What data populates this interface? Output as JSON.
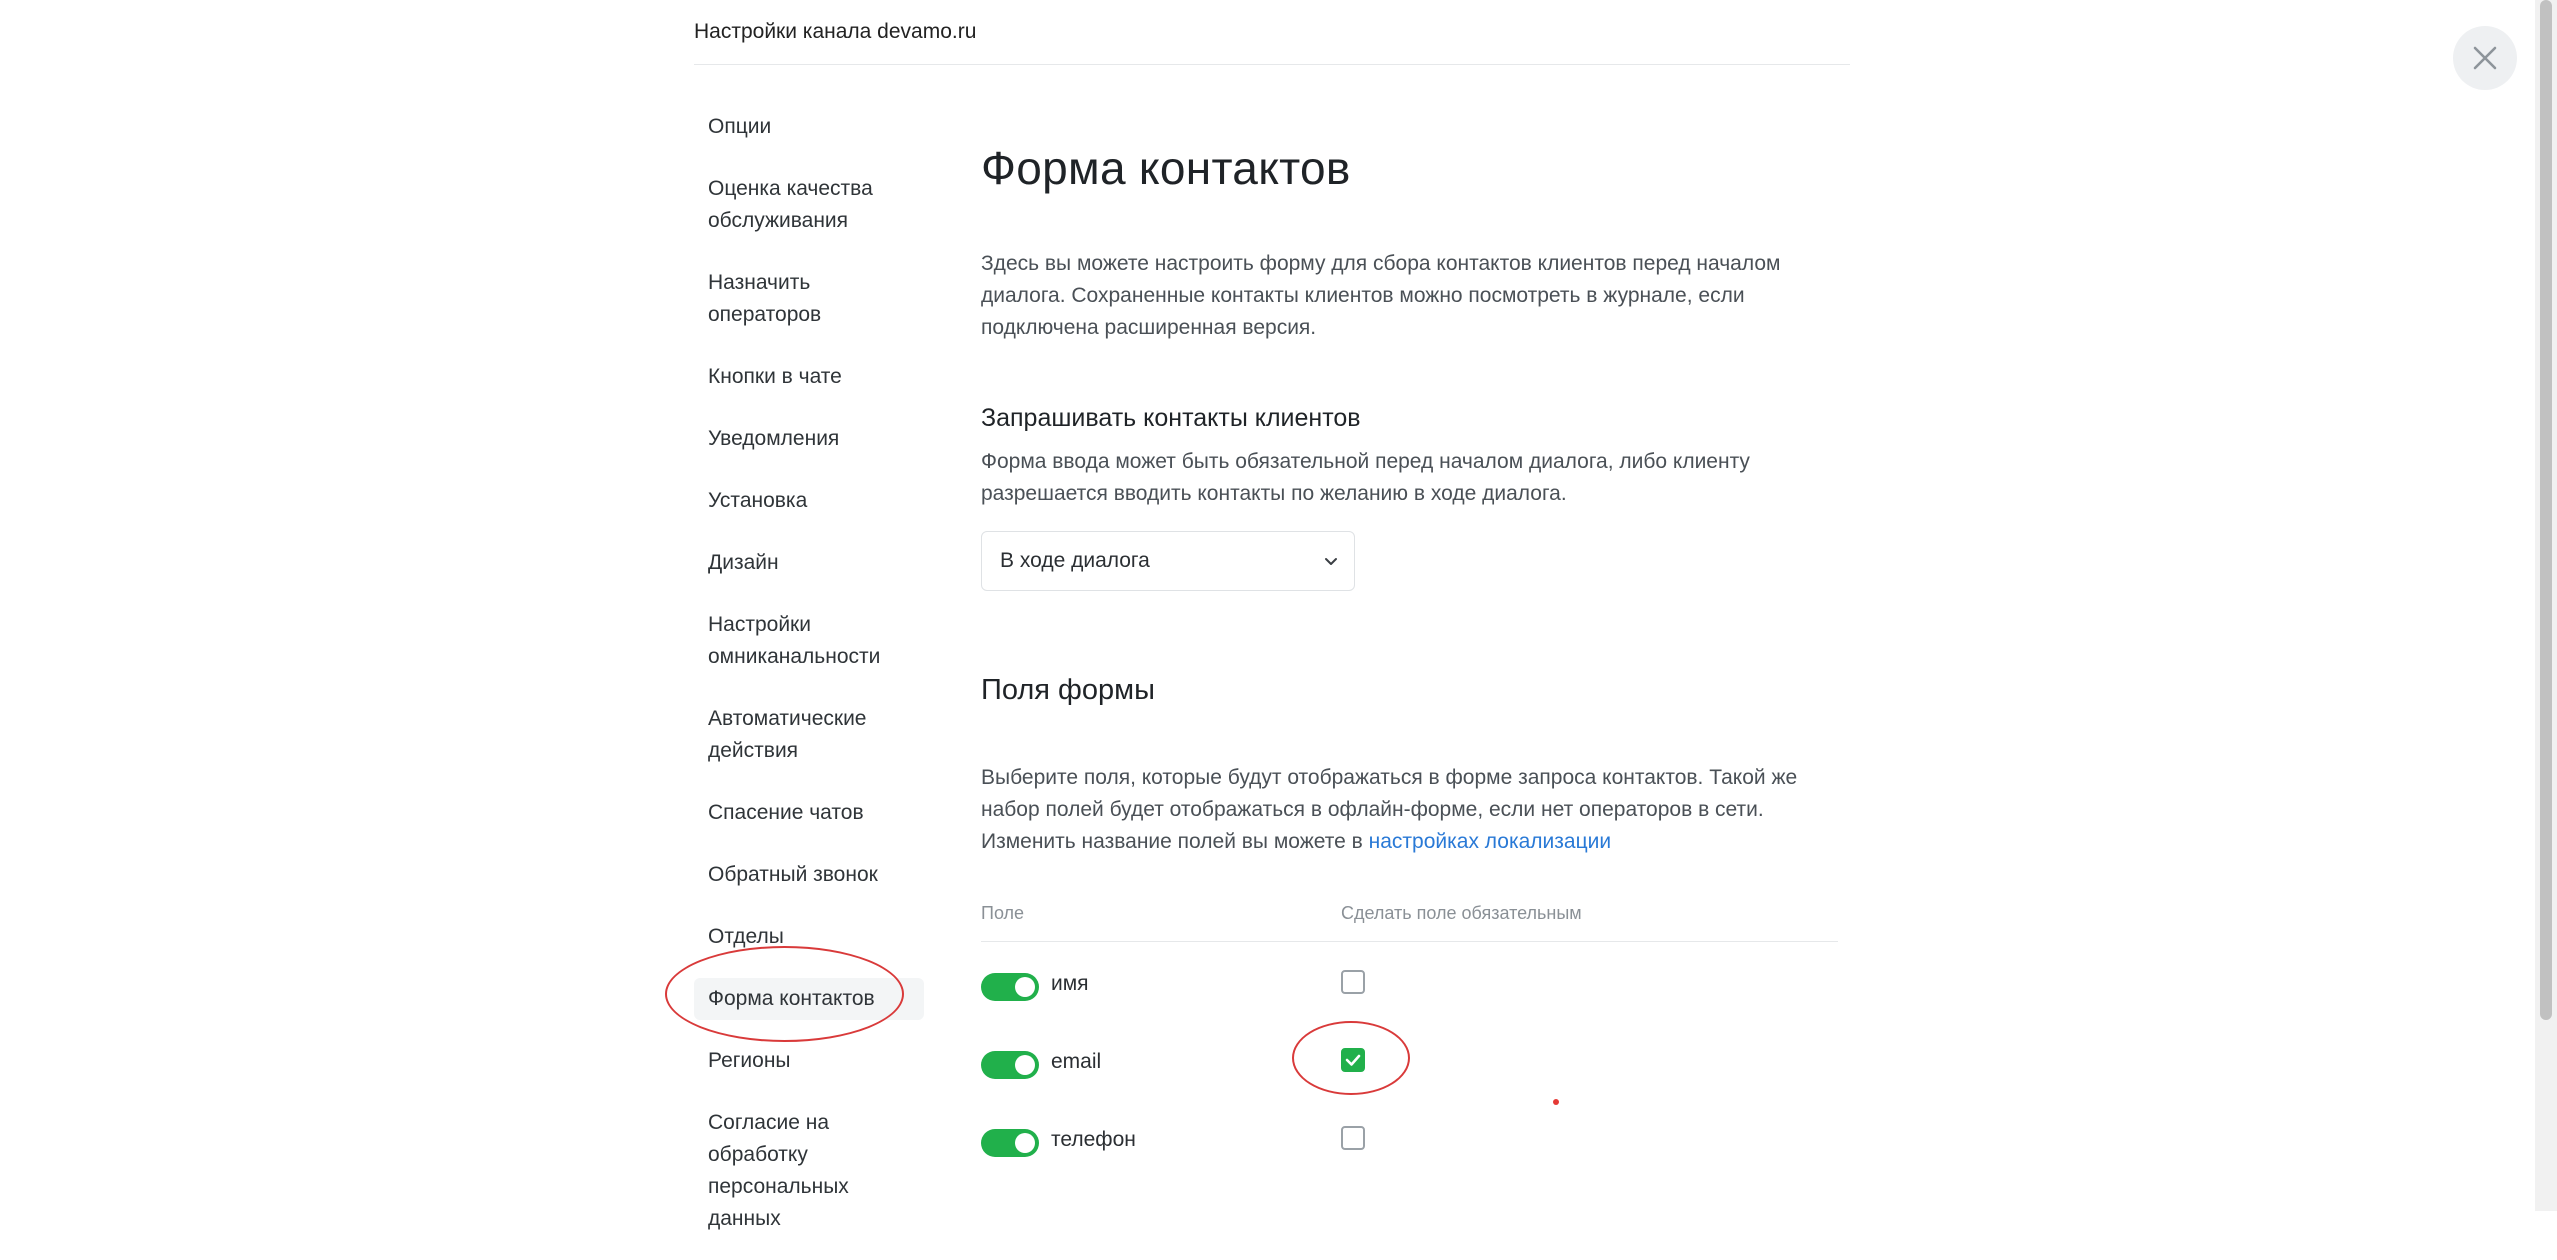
{
  "header": {
    "title": "Настройки канала devamo.ru"
  },
  "sidebar": {
    "items": [
      {
        "label": "Опции"
      },
      {
        "label": "Оценка качества обслуживания"
      },
      {
        "label": "Назначить операторов"
      },
      {
        "label": "Кнопки в чате"
      },
      {
        "label": "Уведомления"
      },
      {
        "label": "Установка"
      },
      {
        "label": "Дизайн"
      },
      {
        "label": "Настройки омниканальности"
      },
      {
        "label": "Автоматические действия"
      },
      {
        "label": "Спасение чатов"
      },
      {
        "label": "Обратный звонок"
      },
      {
        "label": "Отделы"
      },
      {
        "label": "Форма контактов",
        "active": true
      },
      {
        "label": "Регионы"
      },
      {
        "label": "Согласие на обработку персональных данных"
      }
    ]
  },
  "main": {
    "title": "Форма контактов",
    "intro": "Здесь вы можете настроить форму для сбора контактов клиентов перед началом диалога. Сохраненные контакты клиентов можно посмотреть в журнале, если подключена расширенная версия.",
    "request": {
      "heading": "Запрашивать контакты клиентов",
      "desc": "Форма ввода может быть обязательной перед началом диалога, либо клиенту разрешается вводить контакты по желанию в ходе диалога.",
      "select_value": "В ходе диалога"
    },
    "fields": {
      "heading": "Поля формы",
      "desc": "Выберите поля, которые будут отображаться в форме запроса контактов. Такой же набор полей будет отображаться в офлайн-форме, если нет операторов в сети. Изменить название полей вы можете в",
      "link": "настройках локализации",
      "col_field": "Поле",
      "col_required": "Сделать поле обязательным",
      "rows": [
        {
          "label": "имя",
          "enabled": true,
          "required": false
        },
        {
          "label": "email",
          "enabled": true,
          "required": true
        },
        {
          "label": "телефон",
          "enabled": true,
          "required": false
        }
      ]
    }
  },
  "colors": {
    "accent_green": "#21b04b",
    "link_blue": "#2979d6",
    "annotation_red": "#d93a3a"
  }
}
